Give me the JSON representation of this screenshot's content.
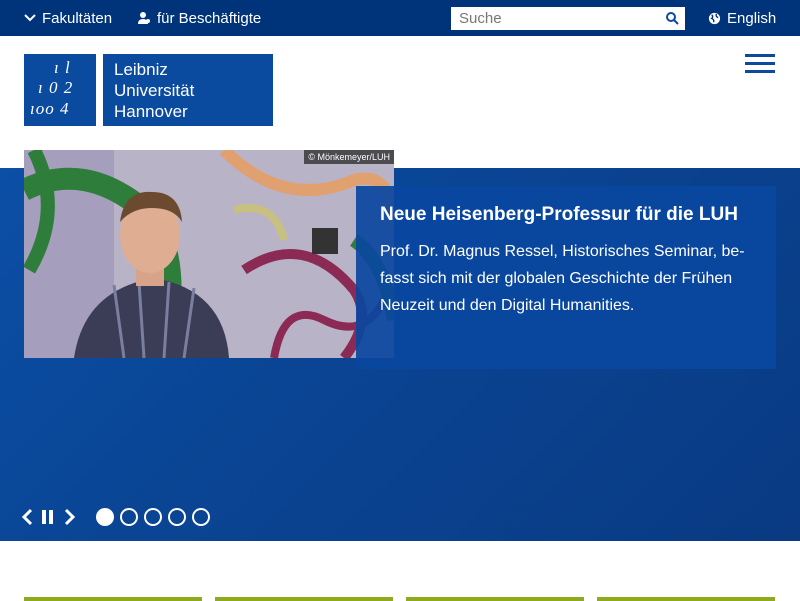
{
  "topbar": {
    "faculties": "Fakultäten",
    "staff": "für Beschäftigte",
    "language": "English",
    "search": {
      "placeholder": "Suche",
      "value": ""
    }
  },
  "logo": {
    "line1": "Leibniz",
    "line2": "Universität",
    "line3": "Hannover",
    "mark_rows": [
      "i l",
      "1 0 2",
      "100 4"
    ]
  },
  "hero": {
    "credit": "© Mönkemeyer/LUH",
    "title": "Neue Heisenberg-Professur für die LUH",
    "text_line1": "Prof. Dr. Magnus Ressel, Historisches Seminar, be-",
    "text_line2": "fasst sich mit der globalen Geschichte der Frühen",
    "text_line3": "Neuzeit und den Digital Humanities.",
    "slides_total": 5,
    "active_slide": 1
  },
  "colors": {
    "topbar": "#00347a",
    "brand": "#0a4a9f",
    "accent_tile": "#8faa1c"
  },
  "icons": [
    "chevron-down-icon",
    "person-icon",
    "search-icon",
    "globe-icon",
    "menu-icon",
    "chevron-left-icon",
    "pause-icon",
    "chevron-right-icon"
  ]
}
